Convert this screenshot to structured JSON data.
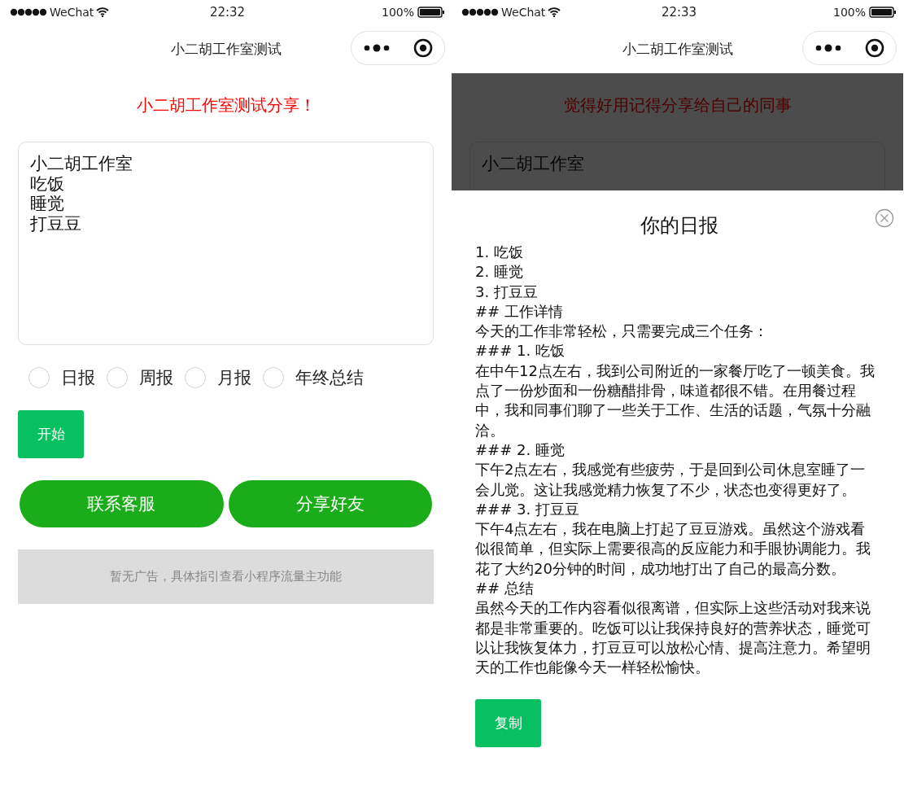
{
  "screens": [
    {
      "status_bar": {
        "app": "WeChat",
        "time": "22:32",
        "battery": "100%"
      },
      "nav_title": "小二胡工作室测试",
      "headline": "小二胡工作室测试分享！",
      "text_field": {
        "lines": [
          "小二胡工作室",
          "吃饭",
          "睡觉",
          "打豆豆"
        ]
      },
      "radios": [
        {
          "label": "日报",
          "selected": false
        },
        {
          "label": "周报",
          "selected": false
        },
        {
          "label": "月报",
          "selected": false
        },
        {
          "label": "年终总结",
          "selected": false
        }
      ],
      "start_button": "开始",
      "buttons": [
        "联系客服",
        "分享好友"
      ],
      "ad_text": "暂无广告，具体指引查看小程序流量主功能"
    },
    {
      "status_bar": {
        "app": "WeChat",
        "time": "22:33",
        "battery": "100%"
      },
      "nav_title": "小二胡工作室测试",
      "headline": "觉得好用记得分享给自己的同事",
      "text_field": {
        "lines": [
          "小二胡工作室"
        ]
      },
      "dimmed": true,
      "sheet": {
        "title": "你的日报",
        "lines": [
          "1. 吃饭",
          "2. 睡觉",
          "3. 打豆豆",
          "## 工作详情",
          "今天的工作非常轻松，只需要完成三个任务：",
          "### 1. 吃饭",
          "在中午12点左右，我到公司附近的一家餐厅吃了一顿美食。我点了一份炒面和一份糖醋排骨，味道都很不错。在用餐过程中，我和同事们聊了一些关于工作、生活的话题，气氛十分融洽。",
          "### 2. 睡觉",
          "下午2点左右，我感觉有些疲劳，于是回到公司休息室睡了一会儿觉。这让我感觉精力恢复了不少，状态也变得更好了。",
          "### 3. 打豆豆",
          "下午4点左右，我在电脑上打起了豆豆游戏。虽然这个游戏看似很简单，但实际上需要很高的反应能力和手眼协调能力。我花了大约20分钟的时间，成功地打出了自己的最高分数。",
          "## 总结",
          "虽然今天的工作内容看似很离谱，但实际上这些活动对我来说都是非常重要的。吃饭可以让我保持良好的营养状态，睡觉可以让我恢复体力，打豆豆可以放松心情、提高注意力。希望明天的工作也能像今天一样轻松愉快。"
        ],
        "copy_button": "复制"
      }
    }
  ]
}
